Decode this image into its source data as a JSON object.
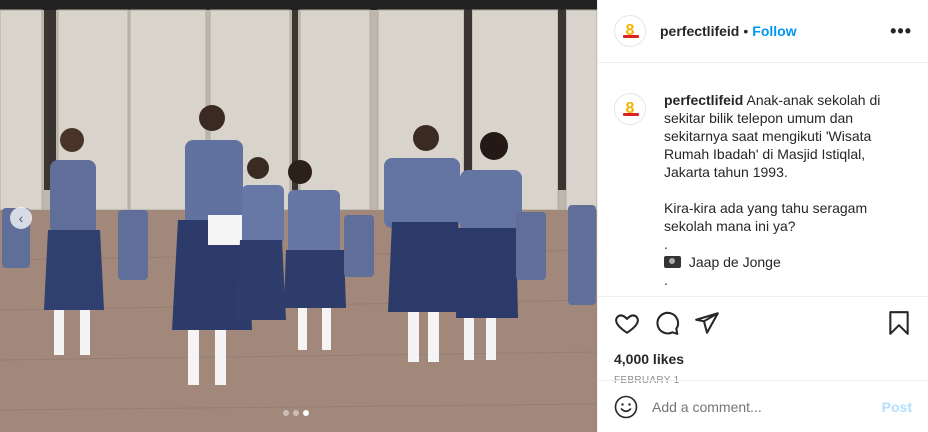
{
  "post": {
    "photo": {
      "alt_icon": "photo-carousel",
      "carousel_dots": 3,
      "active_dot": 3
    },
    "header": {
      "username": "perfectlifeid",
      "separator": "•",
      "follow_label": "Follow",
      "more_icon": "more-horizontal-icon"
    },
    "caption": {
      "username": "perfectlifeid",
      "line1": "Anak-anak sekolah di sekitar bilik telepon umum dan sekitarnya saat mengikuti 'Wisata Rumah Ibadah' di Masjid Istiqlal, Jakarta tahun 1993.",
      "line2": "Kira-kira ada yang tahu seragam sekolah mana ini ya?",
      "dot1": ".",
      "credit_icon": "camera-icon",
      "credit": "Jaap de Jonge",
      "dot2": "."
    },
    "actions": {
      "like_icon": "heart-icon",
      "comment_icon": "comment-icon",
      "share_icon": "share-icon",
      "save_icon": "bookmark-icon"
    },
    "likes": "4,000 likes",
    "date": "FEBRUARY 1",
    "comment": {
      "emoji_icon": "smiley-icon",
      "placeholder": "Add a comment...",
      "post_label": "Post"
    },
    "colors": {
      "accent": "#0095f6",
      "post_disabled": "#b2dffc",
      "muted": "#8e8e8e"
    }
  }
}
